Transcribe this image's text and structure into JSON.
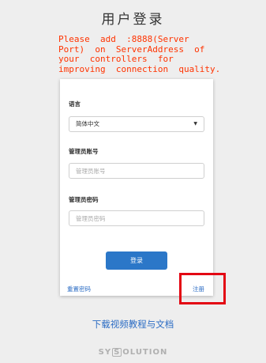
{
  "page": {
    "title": "用户登录",
    "warning": "Please  add  :8888(Server\nPort)  on  ServerAddress  of\nyour  controllers  for\nimproving  connection  quality."
  },
  "form": {
    "language_label": "语言",
    "language_value": "简体中文",
    "account_label": "管理员账号",
    "account_placeholder": "管理员账号",
    "password_label": "管理员密码",
    "password_placeholder": "管理员密码",
    "login_button": "登录",
    "reset_password": "重置密码",
    "register": "注册"
  },
  "footer": {
    "video_link": "下载视频教程与文档",
    "logo_pre": "SY",
    "logo_box": "S",
    "logo_post": "OLUTION"
  },
  "colors": {
    "warning": "#ff3300",
    "accent": "#2b77c8",
    "highlight": "#e30613"
  }
}
